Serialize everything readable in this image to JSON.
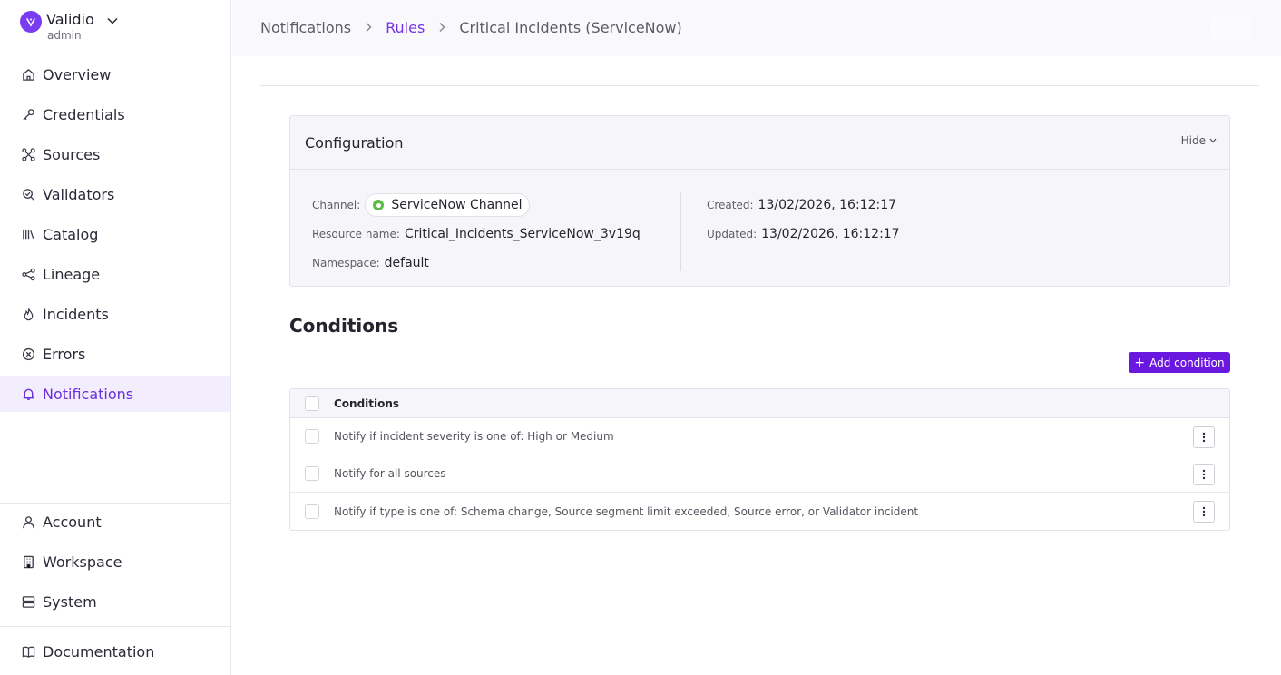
{
  "brand": {
    "name": "Validio",
    "role": "admin"
  },
  "sidebar": {
    "items": [
      {
        "label": "Overview",
        "icon": "home-icon"
      },
      {
        "label": "Credentials",
        "icon": "key-icon"
      },
      {
        "label": "Sources",
        "icon": "sources-icon"
      },
      {
        "label": "Validators",
        "icon": "validators-icon"
      },
      {
        "label": "Catalog",
        "icon": "catalog-icon"
      },
      {
        "label": "Lineage",
        "icon": "lineage-icon"
      },
      {
        "label": "Incidents",
        "icon": "flame-icon"
      },
      {
        "label": "Errors",
        "icon": "error-icon"
      },
      {
        "label": "Notifications",
        "icon": "bell-icon",
        "active": true
      }
    ],
    "bottom_items": [
      {
        "label": "Account",
        "icon": "user-icon"
      },
      {
        "label": "Workspace",
        "icon": "building-icon"
      },
      {
        "label": "System",
        "icon": "server-icon"
      }
    ],
    "documentation": {
      "label": "Documentation",
      "icon": "book-icon"
    }
  },
  "breadcrumb": {
    "items": [
      "Notifications",
      "Rules",
      "Critical Incidents (ServiceNow)"
    ]
  },
  "configuration": {
    "title": "Configuration",
    "hide_label": "Hide",
    "channel_label": "Channel",
    "channel_value": "ServiceNow Channel",
    "resource_name_label": "Resource name",
    "resource_name_value": "Critical_Incidents_ServiceNow_3v19q",
    "namespace_label": "Namespace",
    "namespace_value": "default",
    "created_label": "Created",
    "created_value": "13/02/2026, 16:12:17",
    "updated_label": "Updated",
    "updated_value": "13/02/2026, 16:12:17"
  },
  "conditions": {
    "title": "Conditions",
    "add_button_label": "Add condition",
    "column_header": "Conditions",
    "rows": [
      "Notify if incident severity is one of: High or Medium",
      "Notify for all sources",
      "Notify if type is one of: Schema change, Source segment limit exceeded, Source error, or Validator incident"
    ]
  },
  "colors": {
    "accent": "#7534e6",
    "button": "#6a17e0",
    "active_bg": "#f3eefe"
  }
}
